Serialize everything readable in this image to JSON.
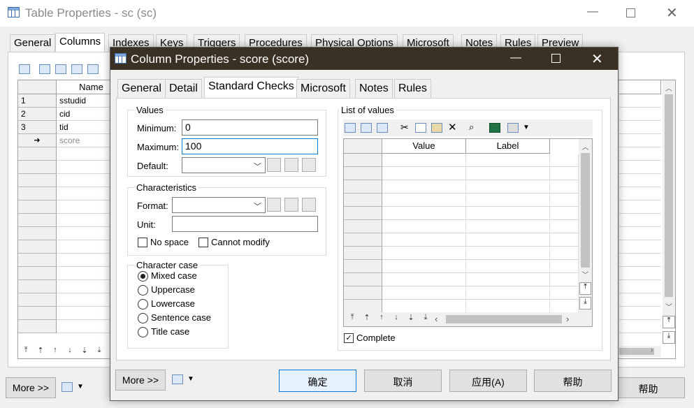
{
  "back_window": {
    "title": "Table Properties - sc (sc)",
    "tabs": [
      "General",
      "Columns",
      "Indexes",
      "Keys",
      "Triggers",
      "Procedures",
      "Physical Options",
      "Microsoft",
      "Notes",
      "Rules",
      "Preview"
    ],
    "selected_tab": "Columns",
    "grid": {
      "header_name": "Name",
      "rows": [
        {
          "num": "1",
          "name": "sstudid"
        },
        {
          "num": "2",
          "name": "cid"
        },
        {
          "num": "3",
          "name": "tid"
        },
        {
          "num": "➜",
          "name": "score"
        }
      ]
    },
    "more_button": "More >>",
    "help_button": "帮助"
  },
  "dialog": {
    "title": "Column Properties - score (score)",
    "tabs": [
      "General",
      "Detail",
      "Standard Checks",
      "Microsoft",
      "Notes",
      "Rules"
    ],
    "selected_tab": "Standard Checks",
    "values_group": {
      "label": "Values",
      "minimum_label": "Minimum:",
      "minimum_value": "0",
      "maximum_label": "Maximum:",
      "maximum_value": "100",
      "default_label": "Default:"
    },
    "characteristics_group": {
      "label": "Characteristics",
      "format_label": "Format:",
      "unit_label": "Unit:",
      "no_space_label": "No space",
      "cannot_modify_label": "Cannot modify"
    },
    "character_case_group": {
      "label": "Character case",
      "options": [
        "Mixed case",
        "Uppercase",
        "Lowercase",
        "Sentence case",
        "Title case"
      ],
      "selected": "Mixed case"
    },
    "list_of_values": {
      "label": "List of values",
      "columns": [
        "Value",
        "Label"
      ],
      "complete_label": "Complete",
      "complete_checked": true
    },
    "buttons": {
      "more": "More >>",
      "ok": "确定",
      "cancel": "取消",
      "apply": "应用(A)",
      "help": "帮助"
    }
  }
}
